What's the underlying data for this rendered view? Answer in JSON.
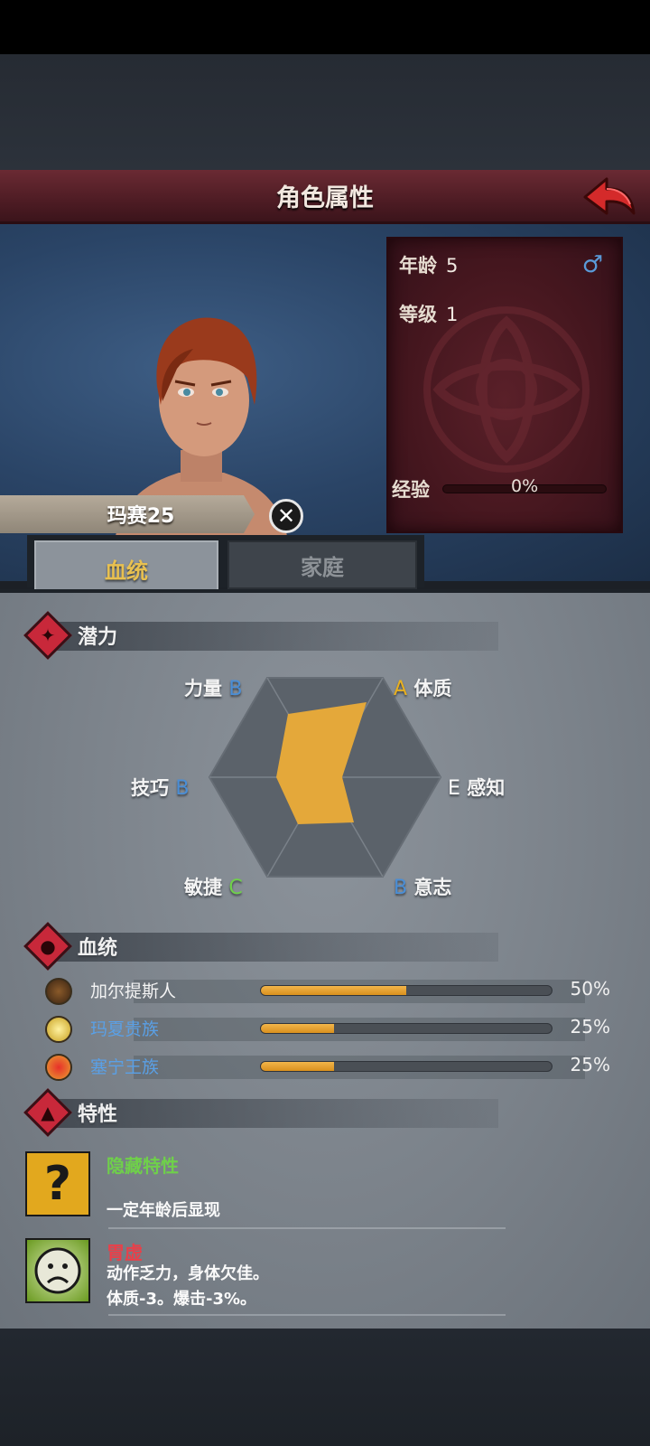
{
  "screen": {
    "title": "角色属性"
  },
  "character": {
    "name": "玛赛25",
    "age_label": "年龄",
    "age_value": "5",
    "level_label": "等级",
    "level_value": "1",
    "gender_icon": "male-symbol-icon",
    "exp_label": "经验",
    "exp_value": "0%",
    "exp_progress": 0
  },
  "tabs": [
    {
      "label": "血统",
      "active": true
    },
    {
      "label": "家庭",
      "active": false
    }
  ],
  "potential": {
    "title": "潜力",
    "stats": [
      {
        "name": "力量",
        "grade": "B",
        "color": "#4a8ed6"
      },
      {
        "name": "体质",
        "grade": "A",
        "color": "#e8b020"
      },
      {
        "name": "技巧",
        "grade": "B",
        "color": "#4a8ed6"
      },
      {
        "name": "感知",
        "grade": "E",
        "color": "#ffffff"
      },
      {
        "name": "敏捷",
        "grade": "C",
        "color": "#6fd04a"
      },
      {
        "name": "意志",
        "grade": "B",
        "color": "#4a8ed6"
      }
    ]
  },
  "bloodline": {
    "title": "血统",
    "items": [
      {
        "name": "加尔提斯人",
        "percent": "50%",
        "value": 0.5,
        "name_color": "#f4f4f4",
        "icon": "bull-emblem-icon"
      },
      {
        "name": "玛夏贵族",
        "percent": "25%",
        "value": 0.25,
        "name_color": "#5aa0e6",
        "icon": "compass-emblem-icon"
      },
      {
        "name": "塞宁王族",
        "percent": "25%",
        "value": 0.25,
        "name_color": "#5aa0e6",
        "icon": "crown-emblem-icon"
      }
    ]
  },
  "traits": {
    "title": "特性",
    "items": [
      {
        "name": "隐藏特性",
        "name_color": "#6fd04a",
        "desc1": "一定年龄后显现",
        "desc2": "",
        "icon": "question-mark-icon"
      },
      {
        "name": "胃虚",
        "name_color": "#e8404a",
        "desc1": "动作乏力，身体欠佳。",
        "desc2": "体质-3。爆击-3%。",
        "icon": "sad-face-icon"
      }
    ]
  },
  "colors": {
    "accent_red": "#c8283a",
    "accent_gold": "#e8b020",
    "radar_fill": "#e4a83a"
  }
}
